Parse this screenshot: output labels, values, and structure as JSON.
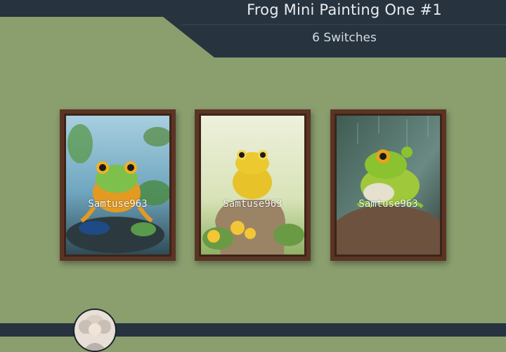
{
  "header": {
    "title": "Frog Mini Painting One #1",
    "subtitle": "6 Switches"
  },
  "paintings": [
    {
      "subject": "orange-green tree frog on dark rock with leaves",
      "watermark": "Samtuse963"
    },
    {
      "subject": "yellow frog on rock with yellow flowers",
      "watermark": "Samtuse963"
    },
    {
      "subject": "green frog on rock in rain",
      "watermark": "Samtuse963"
    }
  ],
  "colors": {
    "background": "#8a9e6e",
    "header_bar": "#27333f",
    "frame": "#5b3424"
  }
}
